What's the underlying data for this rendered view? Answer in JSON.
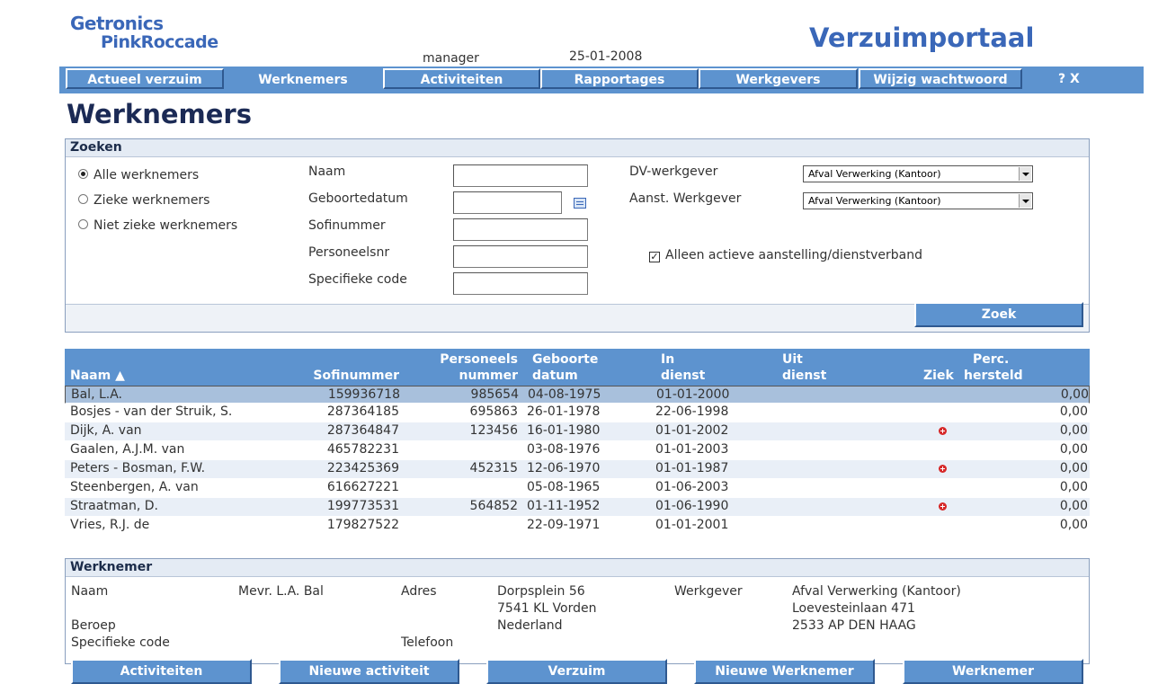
{
  "header": {
    "logo_line1": "Getronics",
    "logo_line2": "PinkRoccade",
    "user": "manager",
    "date": "25-01-2008",
    "portal_title": "Verzuimportaal"
  },
  "nav": {
    "items": [
      "Actueel verzuim",
      "Werknemers",
      "Activiteiten",
      "Rapportages",
      "Werkgevers",
      "Wijzig wachtwoord"
    ],
    "active": "Werknemers",
    "help": "? X"
  },
  "page_title": "Werknemers",
  "search": {
    "heading": "Zoeken",
    "radios": [
      {
        "label": "Alle werknemers",
        "checked": true
      },
      {
        "label": "Zieke werknemers",
        "checked": false
      },
      {
        "label": "Niet zieke werknemers",
        "checked": false
      }
    ],
    "fields": {
      "naam": {
        "label": "Naam",
        "value": ""
      },
      "geboortedatum": {
        "label": "Geboortedatum",
        "value": ""
      },
      "sofinummer": {
        "label": "Sofinummer",
        "value": ""
      },
      "personeelsnr": {
        "label": "Personeelsnr",
        "value": ""
      },
      "specifieke_code": {
        "label": "Specifieke code",
        "value": ""
      }
    },
    "dv_werkgever": {
      "label": "DV-werkgever",
      "value": "Afval Verwerking (Kantoor)"
    },
    "aanst_werkgever": {
      "label": "Aanst. Werkgever",
      "value": "Afval Verwerking (Kantoor)"
    },
    "actief_checkbox": {
      "label": "Alleen actieve aanstelling/dienstverband",
      "checked": true
    },
    "zoek_button": "Zoek"
  },
  "table": {
    "headers": {
      "naam": "Naam ▲",
      "sofinummer": "Sofinummer",
      "personeels1": "Personeels",
      "personeels2": "nummer",
      "geboorte1": "Geboorte",
      "geboorte2": "datum",
      "in1": "In",
      "in2": "dienst",
      "uit1": "Uit",
      "uit2": "dienst",
      "ziek": "Ziek",
      "perc1": "Perc.",
      "perc2": "hersteld"
    },
    "rows": [
      {
        "naam": "Bal, L.A.",
        "sofi": "159936718",
        "pers": "985654",
        "geb": "04-08-1975",
        "in": "01-01-2000",
        "uit": "",
        "ziek": false,
        "perc": "0,00"
      },
      {
        "naam": "Bosjes - van der Struik, S.",
        "sofi": "287364185",
        "pers": "695863",
        "geb": "26-01-1978",
        "in": "22-06-1998",
        "uit": "",
        "ziek": false,
        "perc": "0,00"
      },
      {
        "naam": "Dijk, A. van",
        "sofi": "287364847",
        "pers": "123456",
        "geb": "16-01-1980",
        "in": "01-01-2002",
        "uit": "",
        "ziek": true,
        "perc": "0,00"
      },
      {
        "naam": "Gaalen, A.J.M. van",
        "sofi": "465782231",
        "pers": "",
        "geb": "03-08-1976",
        "in": "01-01-2003",
        "uit": "",
        "ziek": false,
        "perc": "0,00"
      },
      {
        "naam": "Peters - Bosman, F.W.",
        "sofi": "223425369",
        "pers": "452315",
        "geb": "12-06-1970",
        "in": "01-01-1987",
        "uit": "",
        "ziek": true,
        "perc": "0,00"
      },
      {
        "naam": "Steenbergen, A. van",
        "sofi": "616627221",
        "pers": "",
        "geb": "05-08-1965",
        "in": "01-06-2003",
        "uit": "",
        "ziek": false,
        "perc": "0,00"
      },
      {
        "naam": "Straatman, D.",
        "sofi": "199773531",
        "pers": "564852",
        "geb": "01-11-1952",
        "in": "01-06-1990",
        "uit": "",
        "ziek": true,
        "perc": "0,00"
      },
      {
        "naam": "Vries, R.J. de",
        "sofi": "179827522",
        "pers": "",
        "geb": "22-09-1971",
        "in": "01-01-2001",
        "uit": "",
        "ziek": false,
        "perc": "0,00"
      }
    ]
  },
  "employee": {
    "heading": "Werknemer",
    "naam_label": "Naam",
    "naam_value": "Mevr. L.A. Bal",
    "adres_label": "Adres",
    "adres_line1": "Dorpsplein 56",
    "adres_line2": "7541 KL Vorden",
    "adres_line3": "Nederland",
    "werkgever_label": "Werkgever",
    "werkgever_line1": "Afval Verwerking (Kantoor)",
    "werkgever_line2": "Loevesteinlaan 471",
    "werkgever_line3": "2533 AP DEN HAAG",
    "beroep_label": "Beroep",
    "code_label": "Specifieke code",
    "telefoon_label": "Telefoon",
    "buttons": [
      "Activiteiten",
      "Nieuwe activiteit",
      "Verzuim",
      "Nieuwe Werknemer",
      "Werknemer"
    ]
  },
  "colors": {
    "accent": "#5d93cf",
    "title": "#1b2a55",
    "logo": "#3a67b8",
    "sick_marker": "#d62828"
  }
}
